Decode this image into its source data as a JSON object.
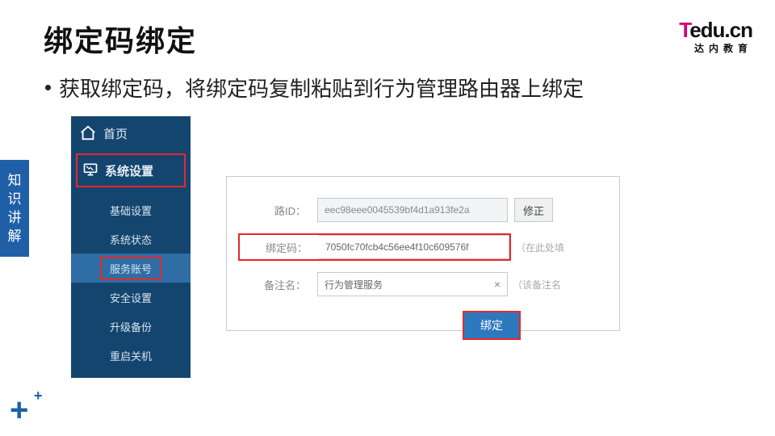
{
  "page": {
    "title": "绑定码绑定",
    "bullet": "获取绑定码，将绑定码复制粘贴到行为管理路由器上绑定"
  },
  "logo": {
    "t": "T",
    "rest": "edu.cn",
    "sub": "达内教育"
  },
  "side_tab": "知识讲解",
  "nav": {
    "home": "首页",
    "system": "系统设置",
    "items": [
      {
        "label": "基础设置"
      },
      {
        "label": "系统状态"
      },
      {
        "label": "服务账号",
        "active": true,
        "highlight": true
      },
      {
        "label": "安全设置"
      },
      {
        "label": "升级备份"
      },
      {
        "label": "重启关机"
      }
    ]
  },
  "form": {
    "route_id": {
      "label": "路ID：",
      "value": "eec98eee0045539bf4d1a913fe2a",
      "button": "修正"
    },
    "bind_code": {
      "label": "绑定码：",
      "value": "7050fc70fcb4c56ee4f10c609576f",
      "hint": "（在此处填"
    },
    "remark": {
      "label": "备注名：",
      "value": "行为管理服务",
      "hint": "（该备注名"
    },
    "bind_button": "绑定"
  }
}
